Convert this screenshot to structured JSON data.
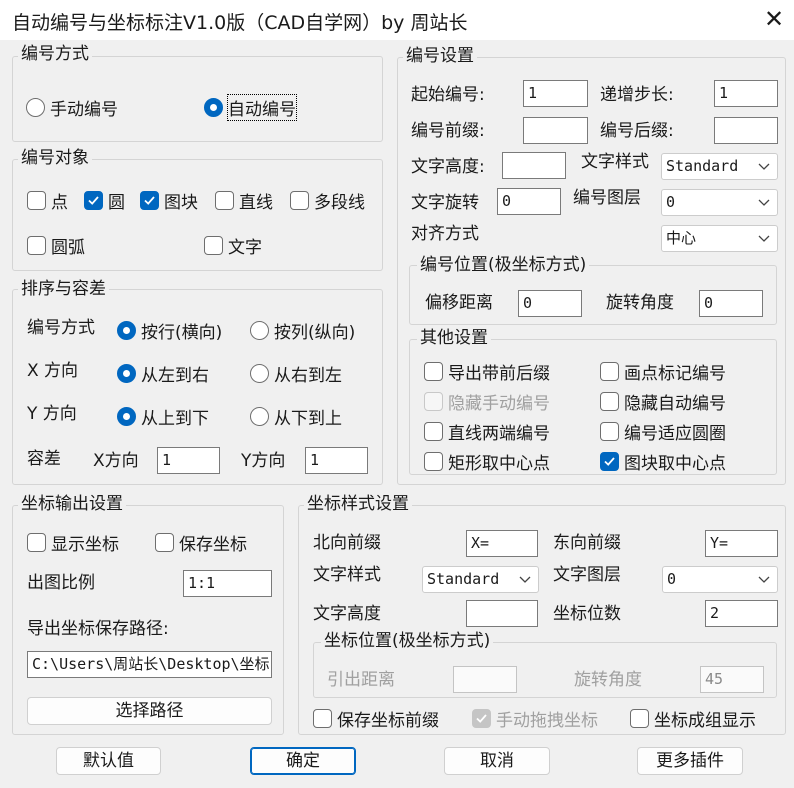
{
  "window": {
    "title": "自动编号与坐标标注V1.0版（CAD自学网）by 周站长",
    "close_glyph": "✕"
  },
  "numbering_method": {
    "title": "编号方式",
    "options": [
      {
        "label": "手动编号",
        "checked": false
      },
      {
        "label": "自动编号",
        "checked": true
      }
    ]
  },
  "numbering_object": {
    "title": "编号对象",
    "items": [
      {
        "label": "点",
        "checked": false
      },
      {
        "label": "圆",
        "checked": true
      },
      {
        "label": "图块",
        "checked": true
      },
      {
        "label": "直线",
        "checked": false
      },
      {
        "label": "多段线",
        "checked": false
      },
      {
        "label": "圆弧",
        "checked": false
      },
      {
        "label": "文字",
        "checked": false
      }
    ]
  },
  "sort": {
    "title": "排序与容差",
    "method_label": "编号方式",
    "method_options": [
      {
        "label": "按行(横向)",
        "checked": true
      },
      {
        "label": "按列(纵向)",
        "checked": false
      }
    ],
    "x_label": "X 方向",
    "x_options": [
      {
        "label": "从左到右",
        "checked": true
      },
      {
        "label": "从右到左",
        "checked": false
      }
    ],
    "y_label": "Y 方向",
    "y_options": [
      {
        "label": "从上到下",
        "checked": true
      },
      {
        "label": "从下到上",
        "checked": false
      }
    ],
    "tol_label": "容差",
    "tol_x_label": "X方向",
    "tol_x_value": "1",
    "tol_y_label": "Y方向",
    "tol_y_value": "1"
  },
  "num_settings": {
    "title": "编号设置",
    "start_label": "起始编号:",
    "start_value": "1",
    "step_label": "递增步长:",
    "step_value": "1",
    "prefix_label": "编号前缀:",
    "prefix_value": "",
    "suffix_label": "编号后缀:",
    "suffix_value": "",
    "height_label": "文字高度:",
    "height_value": "",
    "style_label": "文字样式",
    "style_value": "Standard",
    "rot_label": "文字旋转",
    "rot_value": "0",
    "layer_label": "编号图层",
    "layer_value": "0",
    "align_label": "对齐方式",
    "align_value": "中心",
    "pos_title": "编号位置(极坐标方式)",
    "offset_label": "偏移距离",
    "offset_value": "0",
    "angle_label": "旋转角度",
    "angle_value": "0"
  },
  "other": {
    "title": "其他设置",
    "items": [
      {
        "label": "导出带前后缀",
        "checked": false,
        "disabled": false
      },
      {
        "label": "画点标记编号",
        "checked": false,
        "disabled": false
      },
      {
        "label": "隐藏手动编号",
        "checked": false,
        "disabled": true
      },
      {
        "label": "隐藏自动编号",
        "checked": false,
        "disabled": false
      },
      {
        "label": "直线两端编号",
        "checked": false,
        "disabled": false
      },
      {
        "label": "编号适应圆圈",
        "checked": false,
        "disabled": false
      },
      {
        "label": "矩形取中心点",
        "checked": false,
        "disabled": false
      },
      {
        "label": "图块取中心点",
        "checked": true,
        "disabled": false
      }
    ]
  },
  "coord_output": {
    "title": "坐标输出设置",
    "show_label": "显示坐标",
    "save_label": "保存坐标",
    "scale_label": "出图比例",
    "scale_value": "1:1",
    "path_label": "导出坐标保存路径:",
    "path_value": "C:\\Users\\周站长\\Desktop\\坐标",
    "choose_button": "选择路径"
  },
  "coord_style": {
    "title": "坐标样式设置",
    "north_label": "北向前缀",
    "north_value": "X=",
    "east_label": "东向前缀",
    "east_value": "Y=",
    "style_label": "文字样式",
    "style_value": "Standard",
    "layer_label": "文字图层",
    "layer_value": "0",
    "height_label": "文字高度",
    "height_value": "",
    "digits_label": "坐标位数",
    "digits_value": "2",
    "pos_title": "坐标位置(极坐标方式)",
    "lead_label": "引出距离",
    "lead_value": "",
    "angle_label": "旋转角度",
    "angle_value": "45",
    "save_prefix_label": "保存坐标前缀",
    "drag_label": "手动拖拽坐标",
    "group_label": "坐标成组显示"
  },
  "footer": {
    "default_button": "默认值",
    "ok_button": "确定",
    "cancel_button": "取消",
    "more_button": "更多插件"
  }
}
